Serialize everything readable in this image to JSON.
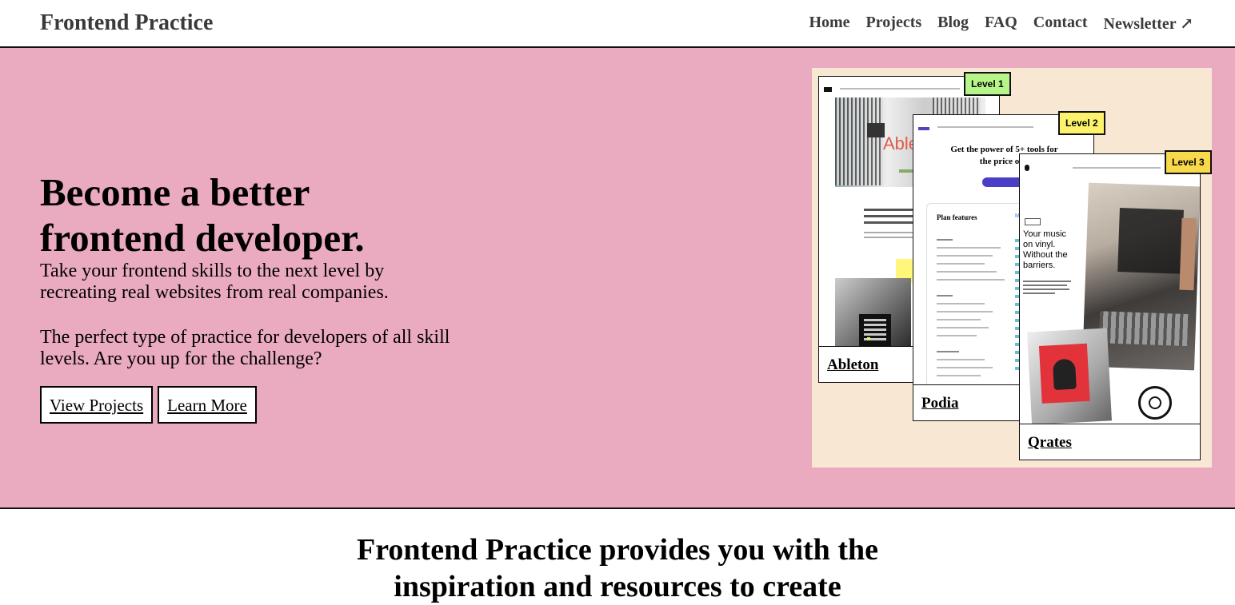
{
  "header": {
    "brand": "Frontend Practice",
    "nav": [
      {
        "label": "Home"
      },
      {
        "label": "Projects"
      },
      {
        "label": "Blog"
      },
      {
        "label": "FAQ"
      },
      {
        "label": "Contact"
      },
      {
        "label": "Newsletter ↗"
      }
    ]
  },
  "hero": {
    "title_line1": "Become a better",
    "title_line2": "frontend developer.",
    "para1": "Take your frontend skills to the next level by recreating real websites from real companies.",
    "para2": "The perfect type of practice for developers of all skill levels. Are you up for the challenge?",
    "primary_button": "View Projects",
    "secondary_button": "Learn More",
    "bg_color": "#eaaac0"
  },
  "collage": {
    "cards": [
      {
        "name": "Ableton",
        "level": "Level 1",
        "badge_color": "#b7f58a"
      },
      {
        "name": "Podia",
        "level": "Level 2",
        "badge_color": "#fdf26b"
      },
      {
        "name": "Qrates",
        "level": "Level 3",
        "badge_color": "#f7d94b"
      }
    ],
    "podia_headline": "Get the power of 5+ tools for the price of o",
    "podia_plan_features": "Plan features",
    "qrates_headline": "Your music on vinyl. Without the barriers.",
    "ableton_overlay": "Able"
  },
  "section": {
    "title_line1": "Frontend Practice provides you with the",
    "title_line2": "inspiration and resources to create"
  }
}
